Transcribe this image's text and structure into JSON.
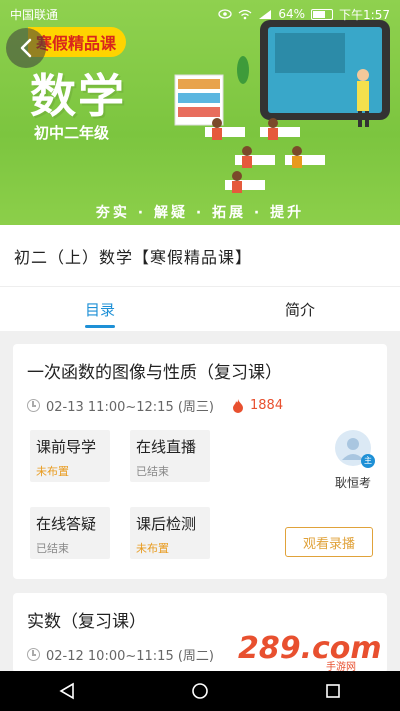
{
  "status_bar": {
    "carrier": "中国联通",
    "battery": "64%",
    "time": "下午1:57"
  },
  "banner": {
    "badge": "寒假精品课",
    "title": "数学",
    "grade": "初中二年级",
    "slogan": "夯实 · 解疑 · 拓展 · 提升",
    "colors": {
      "background": "#8fd14f",
      "badge_bg": "#ffd400",
      "badge_text": "#d9261c"
    }
  },
  "course": {
    "title": "初二（上）数学【寒假精品课】"
  },
  "tabs": [
    {
      "label": "目录",
      "active": true
    },
    {
      "label": "简介",
      "active": false
    }
  ],
  "lessons": [
    {
      "title": "一次函数的图像与性质（复习课）",
      "time": "02-13 11:00~12:15 (周三)",
      "views": "1884",
      "tasks": [
        {
          "name": "课前导学",
          "status": "未布置",
          "status_color": "orange"
        },
        {
          "name": "在线直播",
          "status": "已结束",
          "status_color": "gray"
        },
        {
          "name": "在线答疑",
          "status": "已结束",
          "status_color": "gray"
        },
        {
          "name": "课后检测",
          "status": "未布置",
          "status_color": "orange"
        }
      ],
      "teacher": {
        "name": "耿恒考",
        "badge": "主"
      },
      "replay_label": "观看录播"
    },
    {
      "title": "实数（复习课）",
      "time": "02-12 10:00~11:15 (周二)"
    }
  ],
  "watermark": {
    "text": "289.com",
    "sub": "手游网"
  },
  "accent_color": "#1e90d6"
}
